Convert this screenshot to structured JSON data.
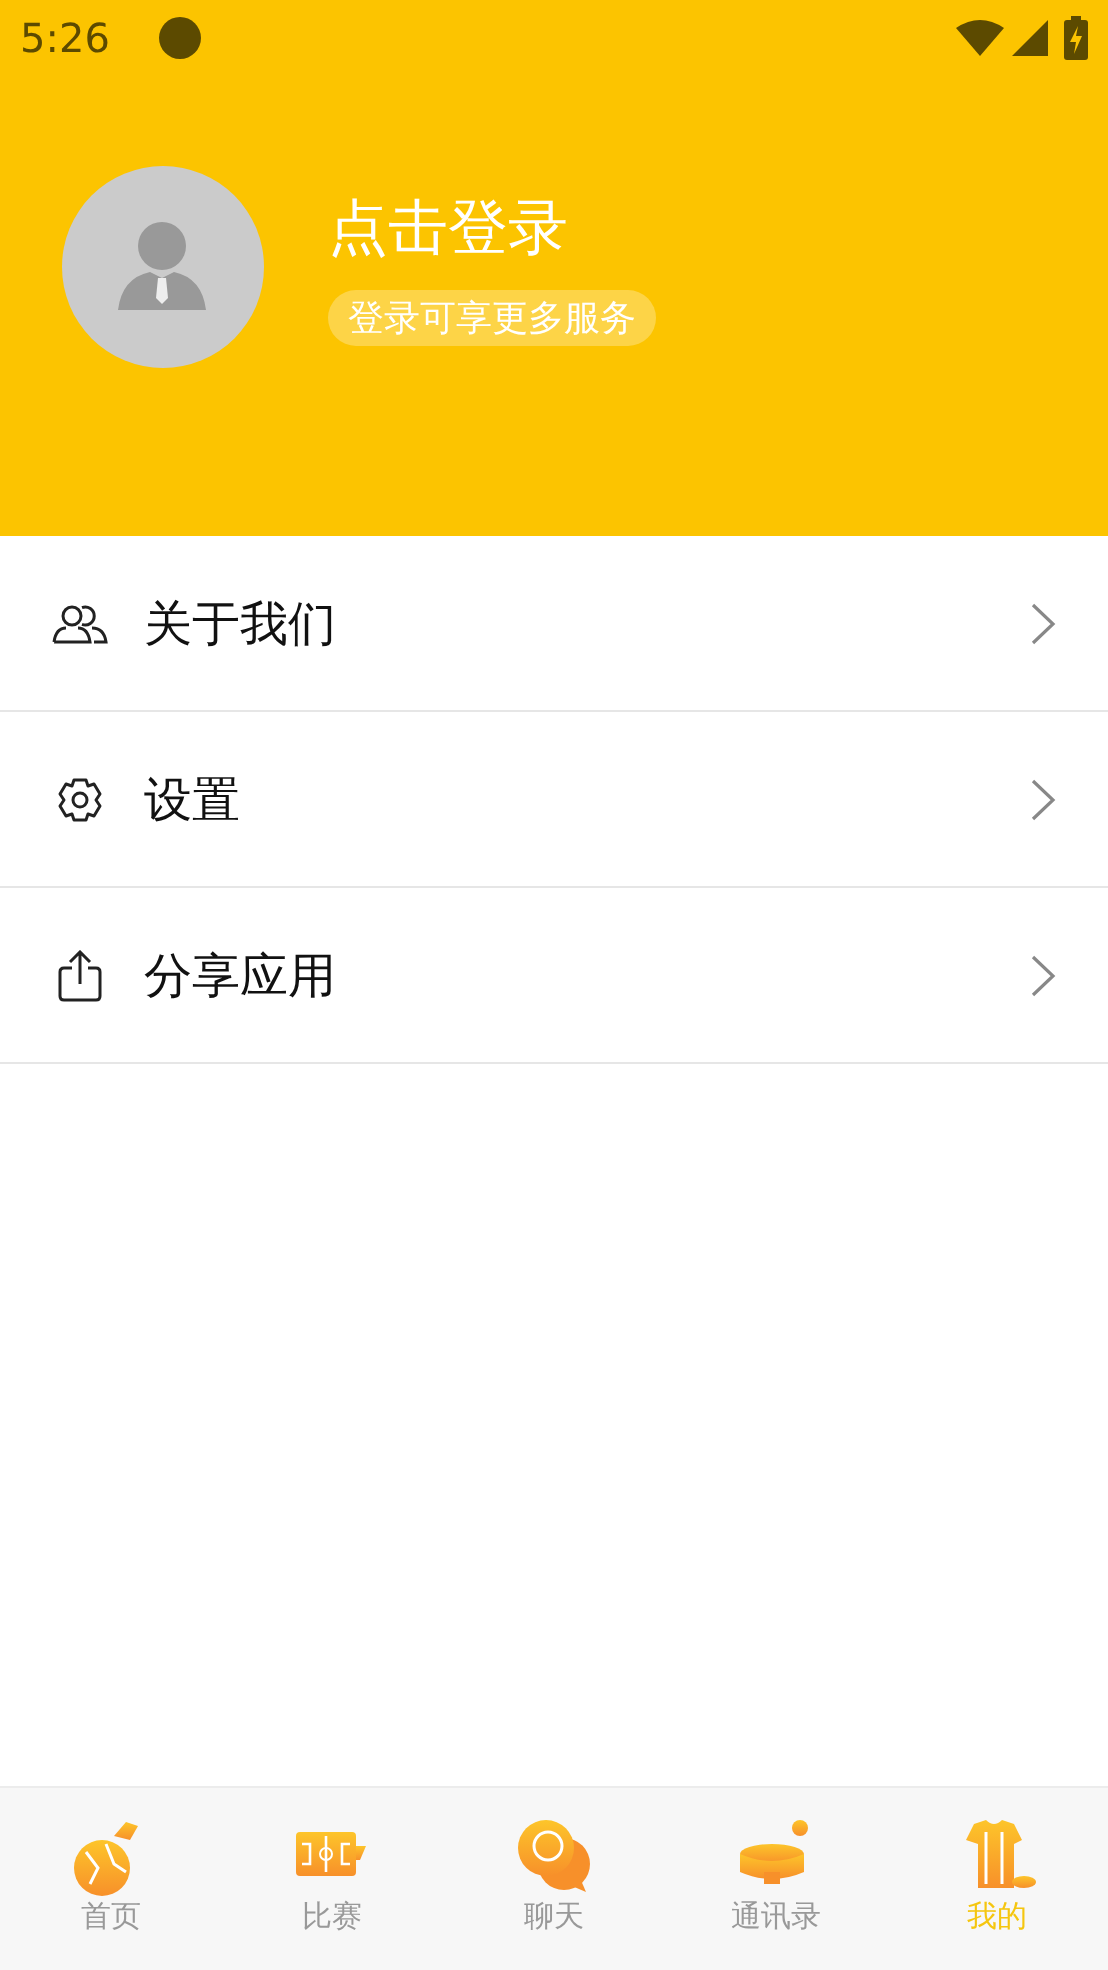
{
  "status_bar": {
    "time": "5:26"
  },
  "profile": {
    "title": "点击登录",
    "subtitle": "登录可享更多服务"
  },
  "menu": [
    {
      "kind": "people",
      "label": "关于我们"
    },
    {
      "kind": "gear",
      "label": "设置"
    },
    {
      "kind": "share",
      "label": "分享应用"
    }
  ],
  "tab_bar": [
    {
      "kind": "ball",
      "label": "首页",
      "selected": false
    },
    {
      "kind": "pitch",
      "label": "比赛",
      "selected": false
    },
    {
      "kind": "chat",
      "label": "聊天",
      "selected": false
    },
    {
      "kind": "stadium",
      "label": "通讯录",
      "selected": false
    },
    {
      "kind": "jersey",
      "label": "我的",
      "selected": true
    }
  ]
}
